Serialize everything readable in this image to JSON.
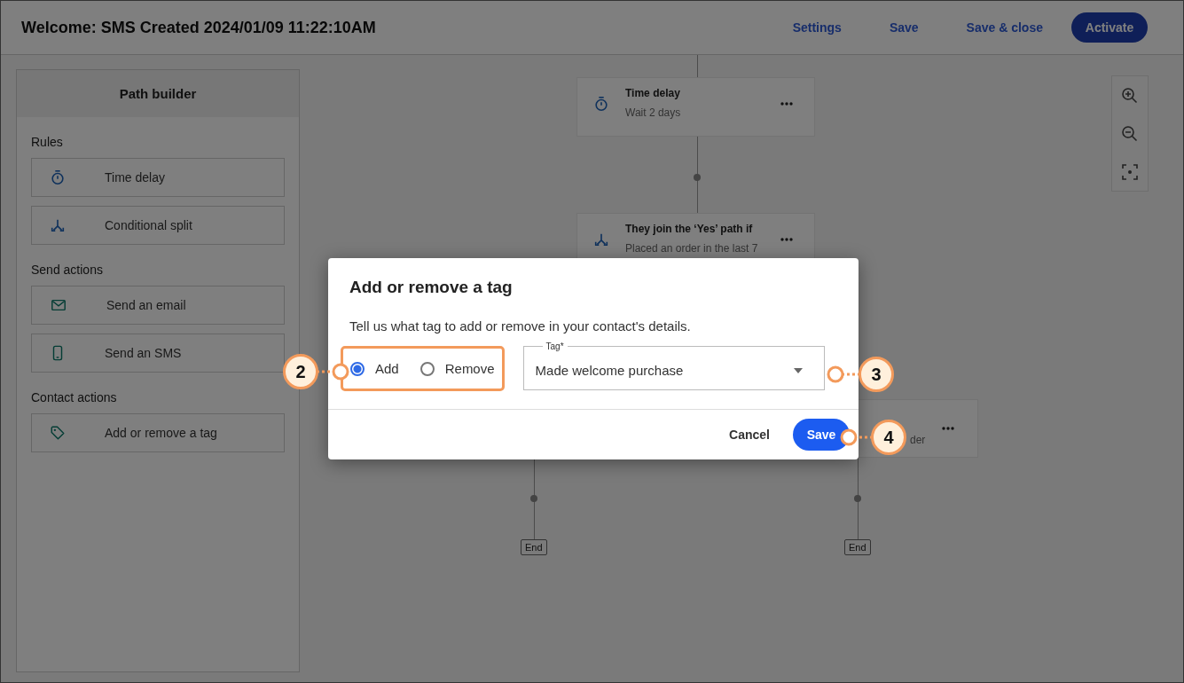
{
  "header": {
    "title": "Welcome: SMS Created 2024/01/09 11:22:10AM",
    "actions": [
      {
        "label": "Settings",
        "kind": "link"
      },
      {
        "label": "Save",
        "kind": "link"
      },
      {
        "label": "Save & close",
        "kind": "link"
      },
      {
        "label": "Activate",
        "kind": "primary"
      }
    ]
  },
  "sidebar": {
    "title": "Path builder",
    "sections": [
      {
        "heading": "Rules",
        "items": [
          {
            "label": "Time delay",
            "kind": "timer"
          },
          {
            "label": "Conditional split",
            "kind": "split"
          }
        ]
      },
      {
        "heading": "Send actions",
        "items": [
          {
            "label": "Send an email",
            "kind": "email"
          },
          {
            "label": "Send an SMS",
            "kind": "sms"
          }
        ]
      },
      {
        "heading": "Contact actions",
        "items": [
          {
            "label": "Add or remove a tag",
            "kind": "tag"
          }
        ]
      }
    ]
  },
  "canvas": {
    "nodes": [
      {
        "title": "Time delay",
        "subtitle": "Wait 2 days",
        "kind": "timer"
      },
      {
        "title": "They join the ‘Yes’ path if",
        "subtitle": "Placed an order in the last 7",
        "kind": "split"
      },
      {
        "subtitle": "der",
        "kind": "partial"
      }
    ],
    "ends": [
      "End",
      "End"
    ]
  },
  "dialog": {
    "title": "Add or remove a tag",
    "description": "Tell us what tag to add or remove in your contact's details.",
    "options": [
      {
        "label": "Add",
        "selected": true
      },
      {
        "label": "Remove",
        "selected": false
      }
    ],
    "tag_field": {
      "label": "Tag*",
      "value": "Made welcome purchase"
    },
    "buttons": [
      {
        "label": "Cancel",
        "kind": "secondary"
      },
      {
        "label": "Save",
        "kind": "primary"
      }
    ]
  },
  "callouts": [
    "2",
    "3",
    "4"
  ]
}
